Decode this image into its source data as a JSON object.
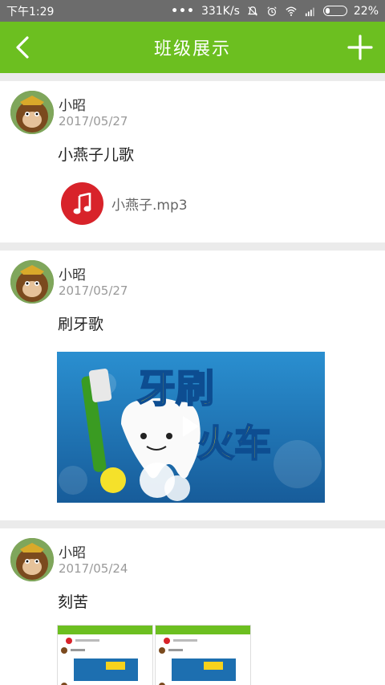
{
  "status": {
    "time": "下午1:29",
    "dots": "•••",
    "speed": "331K/s",
    "battery": "22%",
    "battery_level": 0.22
  },
  "header": {
    "title": "班级展示",
    "back_icon": "back-arrow-icon",
    "add_icon": "plus-icon"
  },
  "posts": [
    {
      "author": "小昭",
      "date": "2017/05/27",
      "caption": "小燕子儿歌",
      "attachment": {
        "type": "audio",
        "icon": "music-note-icon",
        "filename": "小燕子.mp3",
        "color": "#d8232a"
      }
    },
    {
      "author": "小昭",
      "date": "2017/05/27",
      "caption": "刷牙歌",
      "attachment": {
        "type": "video",
        "icon": "play-icon",
        "overlay_text": "牙刷火车"
      }
    },
    {
      "author": "小昭",
      "date": "2017/05/24",
      "caption": "刻苦",
      "attachment": {
        "type": "images",
        "count": 2
      }
    }
  ],
  "colors": {
    "accent": "#6cbf20",
    "statusbar": "#6c6c6c",
    "audio": "#d8232a"
  }
}
